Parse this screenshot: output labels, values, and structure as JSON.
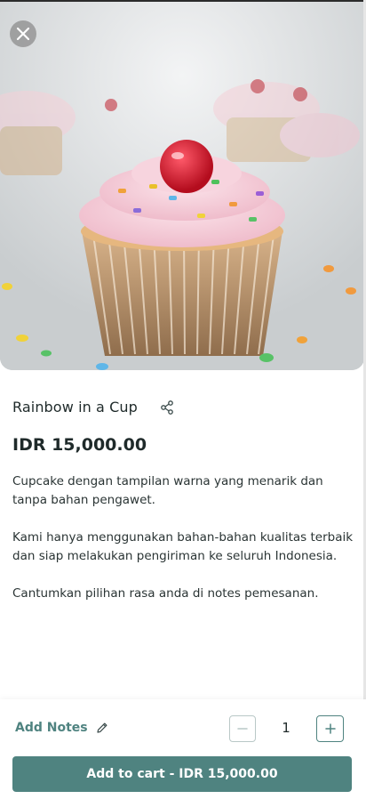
{
  "product": {
    "title": "Rainbow in a Cup",
    "price": "IDR 15,000.00",
    "description": [
      "Cupcake dengan tampilan warna yang menarik dan tanpa bahan pengawet.",
      "Kami hanya menggunakan bahan-bahan kualitas terbaik dan siap melakukan pengiriman ke seluruh Indonesia.",
      "Cantumkan pilihan rasa anda di notes pemesanan."
    ],
    "image_icon": "cupcake-photo"
  },
  "footer": {
    "add_notes_label": "Add Notes",
    "quantity": "1",
    "cart_button_label": "Add to cart - IDR 15,000.00"
  },
  "icons": {
    "close": "close-icon",
    "share": "share-icon",
    "pencil": "pencil-icon",
    "minus": "minus-icon",
    "plus": "plus-icon"
  },
  "colors": {
    "accent": "#4f8380",
    "text": "#1f2a2a",
    "minus_border": "#b9c8c7"
  }
}
